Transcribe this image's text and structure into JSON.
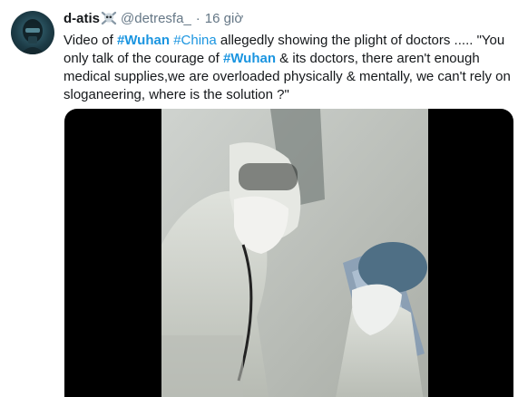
{
  "tweet": {
    "display_name": "d-atis",
    "name_emoji": "skull-crossbones-icon",
    "handle": "@detresfa_",
    "separator": "·",
    "timestamp": "16 giờ",
    "text": {
      "t1": "Video of ",
      "h1": "#Wuhan",
      "t2": " ",
      "h2": "#China",
      "t3": " allegedly showing the plight of doctors ..... \"You only talk of the courage of ",
      "h3": "#Wuhan",
      "t4": " & its doctors, there aren't enough medical supplies,we are overloaded physically & mentally, we can't rely on sloganeering, where is the solution ?\""
    }
  },
  "colors": {
    "link": "#1b95e0",
    "secondary_text": "#657786",
    "primary_text": "#14171a",
    "media_background": "#000000"
  }
}
